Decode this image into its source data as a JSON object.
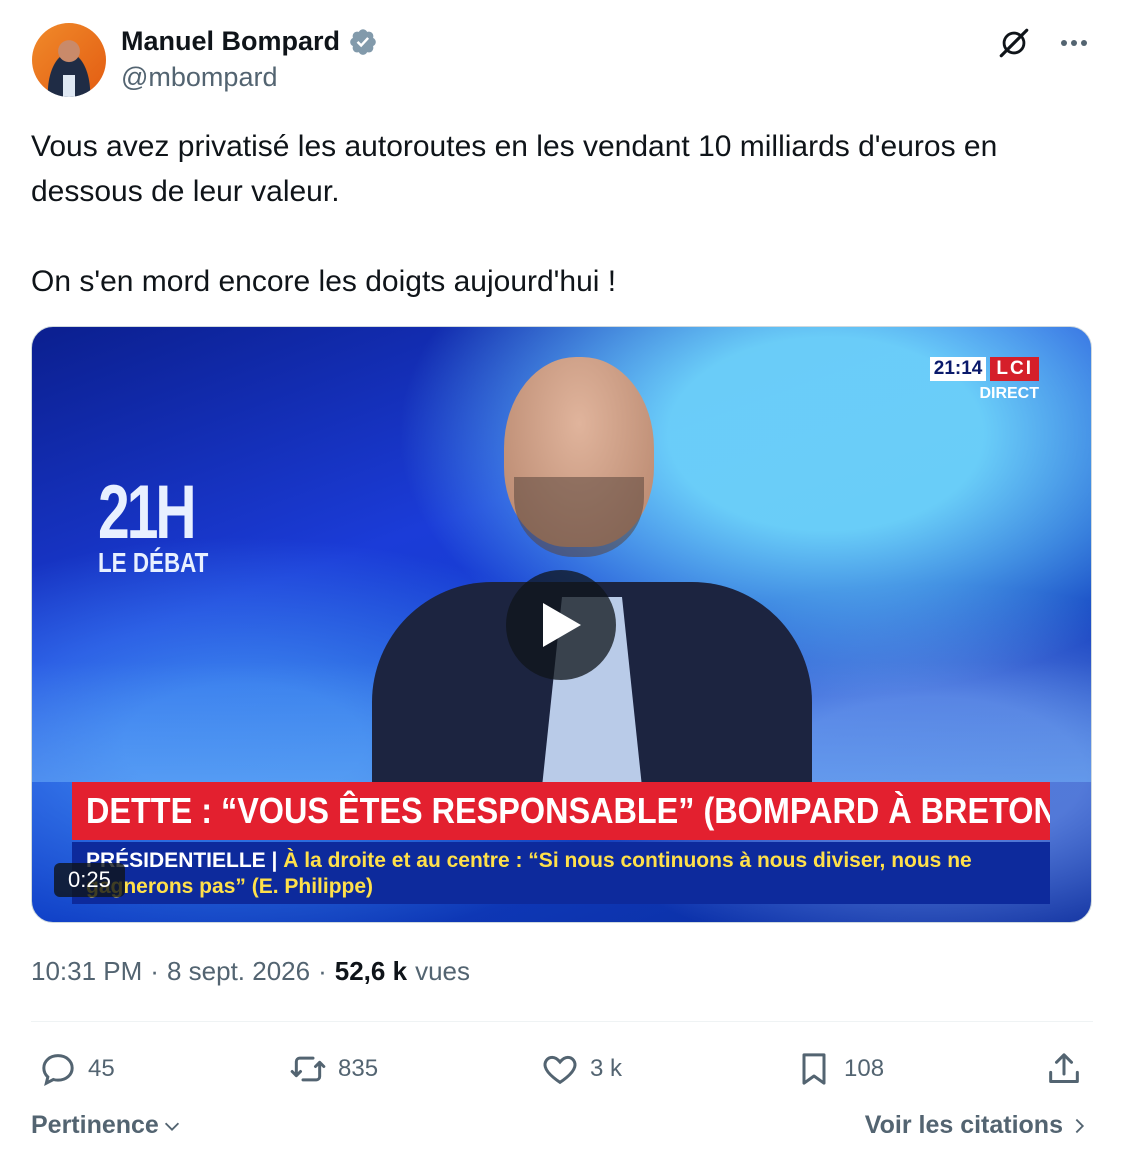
{
  "author": {
    "display_name": "Manuel Bompard",
    "handle": "@mbompard"
  },
  "tweet": {
    "text": "Vous avez privatisé les autoroutes en les vendant 10 milliards d'euros en dessous de leur valeur.\n\nOn s'en mord encore les doigts aujourd'hui !"
  },
  "media": {
    "show_logo_big": "21H",
    "show_logo_small": "LE DÉBAT",
    "clock": "21:14",
    "channel": "LCI",
    "live": "DIRECT",
    "headline": "DETTE : “VOUS ÊTES RESPONSABLE” (BOMPARD À BRETON)",
    "sub_tag": "PRÉSIDENTIELLE",
    "sub_text": "À la droite et au centre : “Si nous continuons à nous diviser, nous ne gagnerons pas” (E. Philippe)",
    "duration": "0:25"
  },
  "meta": {
    "time": "10:31 PM",
    "date": "8 sept. 2026",
    "views_count": "52,6 k",
    "views_label": "vues"
  },
  "actions": {
    "replies": "45",
    "reposts": "835",
    "likes": "3 k",
    "bookmarks": "108"
  },
  "footer": {
    "sort_label": "Pertinence",
    "quotes_label": "Voir les citations"
  },
  "colors": {
    "verified": "#829aab",
    "text_secondary": "#536471",
    "headline_band": "#e3202f"
  }
}
